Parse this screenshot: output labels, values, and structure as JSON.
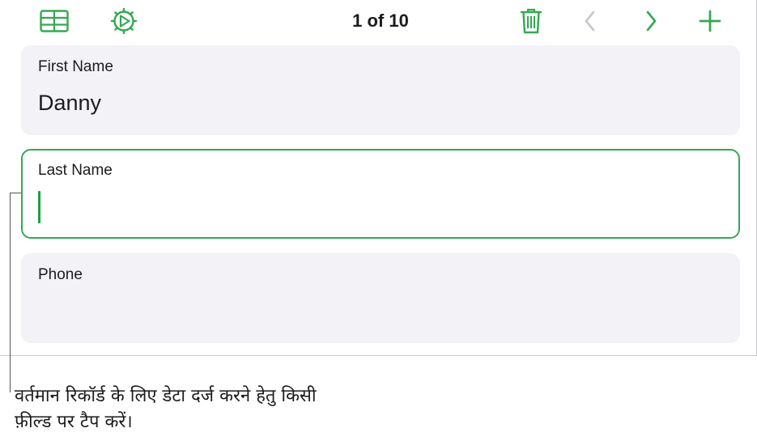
{
  "toolbar": {
    "record_counter": "1 of 10",
    "icons": {
      "table_view": "table-icon",
      "format": "gear-icon",
      "delete": "trash-icon",
      "previous": "chevron-left-icon",
      "next": "chevron-right-icon",
      "add": "plus-icon"
    }
  },
  "fields": [
    {
      "label": "First Name",
      "value": "Danny"
    },
    {
      "label": "Last Name",
      "value": ""
    },
    {
      "label": "Phone",
      "value": ""
    }
  ],
  "callout": {
    "text": "वर्तमान रिकॉर्ड के लिए डेटा दर्ज करने हेतु किसी फ़ील्ड पर टैप करें।"
  },
  "colors": {
    "accent_green": "#34a853",
    "disabled_gray": "#c7c7cc",
    "field_background": "#f2f2f7"
  }
}
